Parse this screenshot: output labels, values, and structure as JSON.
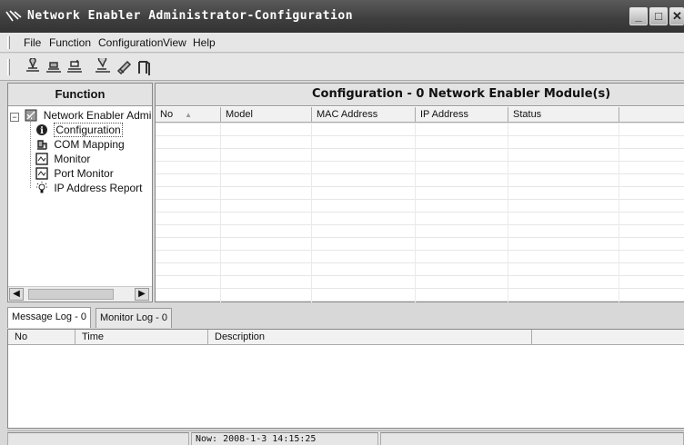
{
  "window": {
    "title": "Network Enabler Administrator-Configuration"
  },
  "menu": [
    {
      "label": "File"
    },
    {
      "label": "Function"
    },
    {
      "label": "Configuration"
    },
    {
      "label": "View"
    },
    {
      "label": "Help"
    }
  ],
  "toolbar": {
    "icons": [
      "search-network-icon",
      "locate-icon",
      "unlock-icon",
      "broadcast-icon",
      "settings-icon",
      "exit-icon"
    ]
  },
  "function_panel": {
    "header": "Function",
    "tree": {
      "root": "Network Enabler Admir",
      "children": [
        "Configuration",
        "COM Mapping",
        "Monitor",
        "Port Monitor",
        "IP Address Report"
      ]
    }
  },
  "config_panel": {
    "header": "Configuration - 0 Network Enabler Module(s)",
    "columns": [
      "No",
      "Model",
      "MAC Address",
      "IP Address",
      "Status"
    ],
    "sort_indicator": "▲"
  },
  "tabs": [
    {
      "label": "Message Log - 0"
    },
    {
      "label": "Monitor Log - 0"
    }
  ],
  "log_panel": {
    "columns": [
      "No",
      "Time",
      "Description"
    ]
  },
  "statusbar": {
    "time": "Now: 2008-1-3 14:15:25"
  },
  "colors": {
    "titlebar": "#3e3e3e",
    "panel_header": "#e3e3e3",
    "background": "#d8d8d8"
  }
}
